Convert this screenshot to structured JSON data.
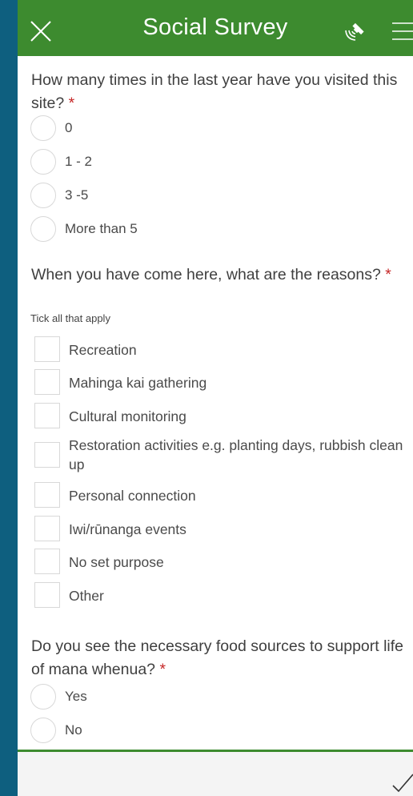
{
  "header": {
    "title": "Social Survey",
    "close_icon": "close-icon",
    "gps_icon": "gps-satellite-icon",
    "menu_icon": "menu-icon",
    "color": "#3d8b2f"
  },
  "q1": {
    "text": "How many times in the last year have you visited this site?",
    "required": "*",
    "options": [
      "0",
      "1 - 2",
      "3 -5",
      "More than 5"
    ]
  },
  "q2": {
    "text": "When you have come here, what are the reasons?",
    "required": "*",
    "hint": "Tick all that apply",
    "options": [
      "Recreation",
      "Mahinga kai gathering",
      "Cultural monitoring",
      "Restoration activities e.g. planting days, rubbish clean up",
      "Personal connection",
      "Iwi/rūnanga events",
      "No set purpose",
      "Other"
    ]
  },
  "q3": {
    "text": "Do you see the necessary food sources to support life of mana whenua?",
    "required": "*",
    "options": [
      "Yes",
      "No"
    ]
  },
  "footer": {
    "submit_icon": "checkmark-icon"
  }
}
